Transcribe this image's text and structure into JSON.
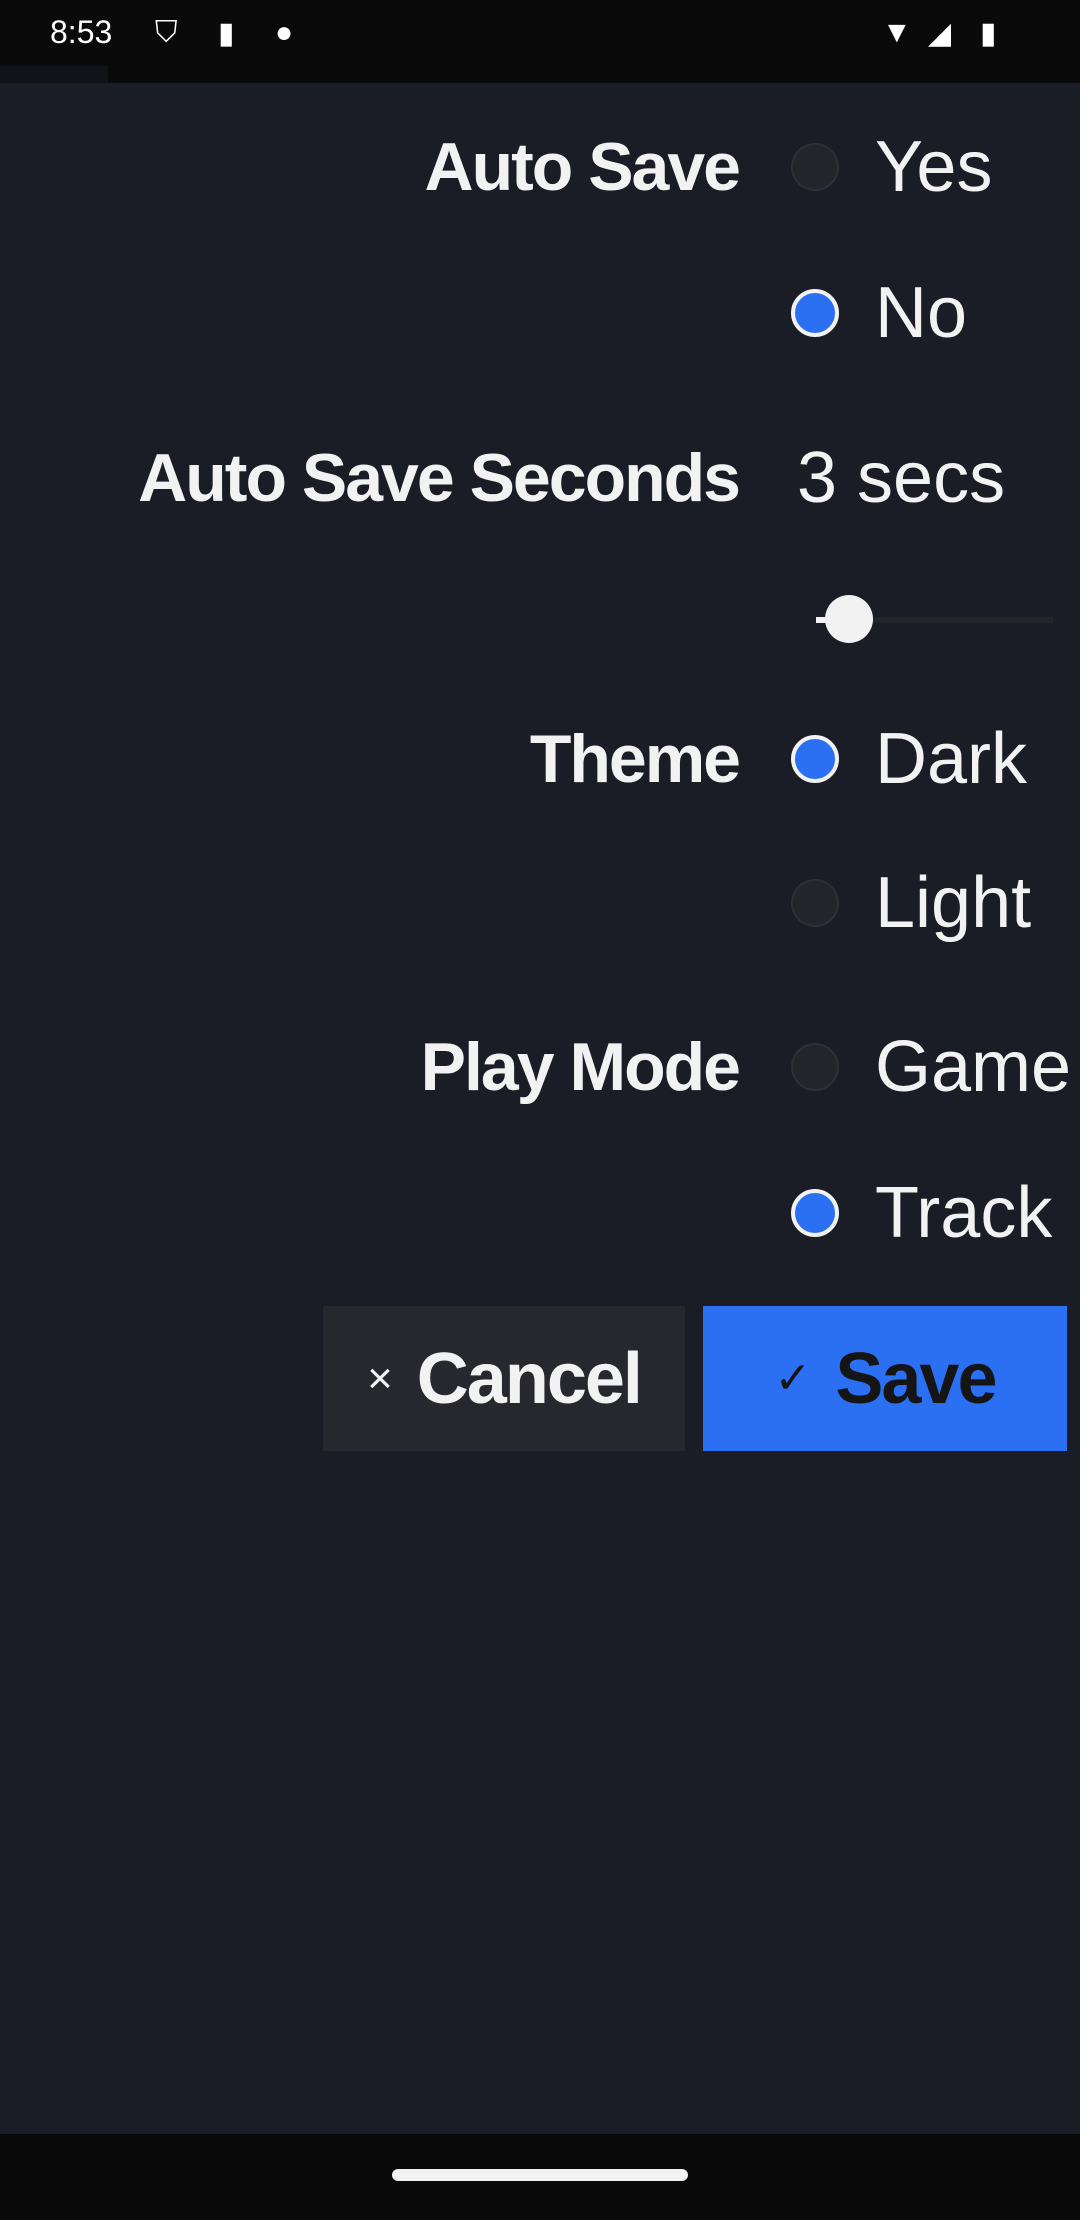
{
  "status_bar": {
    "time": "8:53",
    "icons": [
      "shield-icon",
      "sd-card-icon",
      "cat-icon",
      "wifi-icon",
      "signal-icon",
      "battery-icon"
    ]
  },
  "settings": {
    "auto_save": {
      "label": "Auto Save",
      "options": [
        "Yes",
        "No"
      ],
      "selected": "No"
    },
    "auto_save_seconds": {
      "label": "Auto Save Seconds",
      "value_text": "3 secs",
      "slider_value": 3
    },
    "theme": {
      "label": "Theme",
      "options": [
        "Dark",
        "Light"
      ],
      "selected": "Dark"
    },
    "play_mode": {
      "label": "Play Mode",
      "options": [
        "Game",
        "Track"
      ],
      "selected": "Track"
    }
  },
  "buttons": {
    "cancel": "Cancel",
    "save": "Save",
    "cancel_icon": "×",
    "save_icon": "✓"
  },
  "colors": {
    "accent": "#2b6ff2",
    "background": "#1a1d26"
  }
}
